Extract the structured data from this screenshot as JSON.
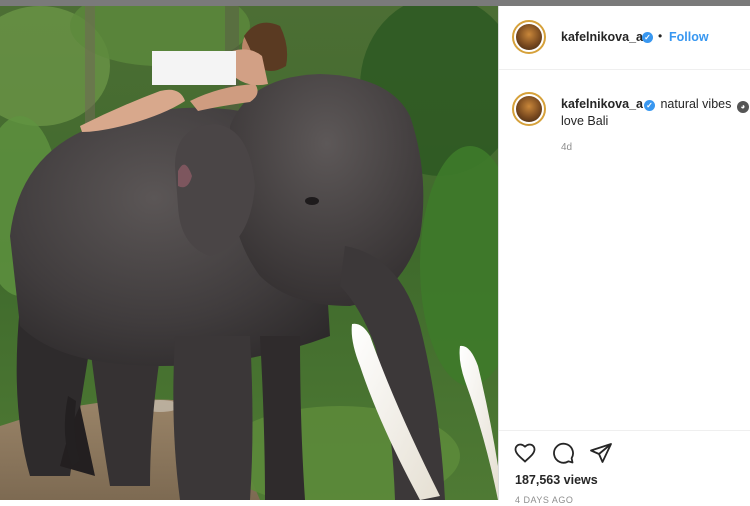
{
  "post": {
    "username": "kafelnikova_a",
    "follow_label": "Follow",
    "separator": "•",
    "caption_text": "natural vibes",
    "caption_line2": "love Bali",
    "timestamp": "4d",
    "views": "187,563 views",
    "ago_label": "4 DAYS AGO"
  },
  "icons": {
    "verified": "verified-badge-icon",
    "emoji": "monkey-emoji-icon",
    "like": "heart-icon",
    "comment": "comment-bubble-icon",
    "share": "send-paper-plane-icon"
  },
  "colors": {
    "link_blue": "#3897f0",
    "text": "#262626",
    "muted": "#8e8e8e",
    "border": "#dbdbdb"
  }
}
